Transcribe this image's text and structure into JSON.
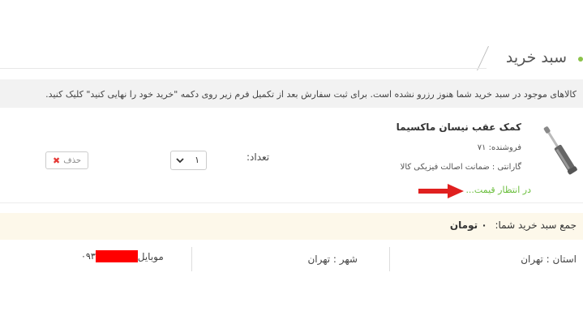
{
  "header": {
    "title": "سبد خرید"
  },
  "notice": {
    "text": "کالاهای موجود در سبد خرید شما هنوز رزرو نشده است. برای ثبت سفارش بعد از تکمیل فرم زیر روی دکمه \"خرید خود را نهایی کنید\" کلیک کنید."
  },
  "product": {
    "name": "کمک عقب نیسان ماکسیما",
    "seller": "فروشنده: ۷۱",
    "warranty": "گارانتی : ضمانت اصالت فیزیکی کالا",
    "price_status": "در انتظار قیمت..."
  },
  "quantity": {
    "label": "تعداد:",
    "value": "۱"
  },
  "delete_button": {
    "label": "حذف"
  },
  "total": {
    "label": "جمع سبد خرید شما:",
    "value": "۰ تومان"
  },
  "address": {
    "province": "استان : تهران",
    "city": "شهر : تهران",
    "mobile_label": "موبایل",
    "mobile_prefix": "۰۹۳"
  },
  "colors": {
    "accent_green": "#6abe3c",
    "annotation_red": "#e0201f"
  },
  "icons": [
    "delete-x-icon",
    "chevron-down-icon",
    "annotation-arrow-icon"
  ]
}
